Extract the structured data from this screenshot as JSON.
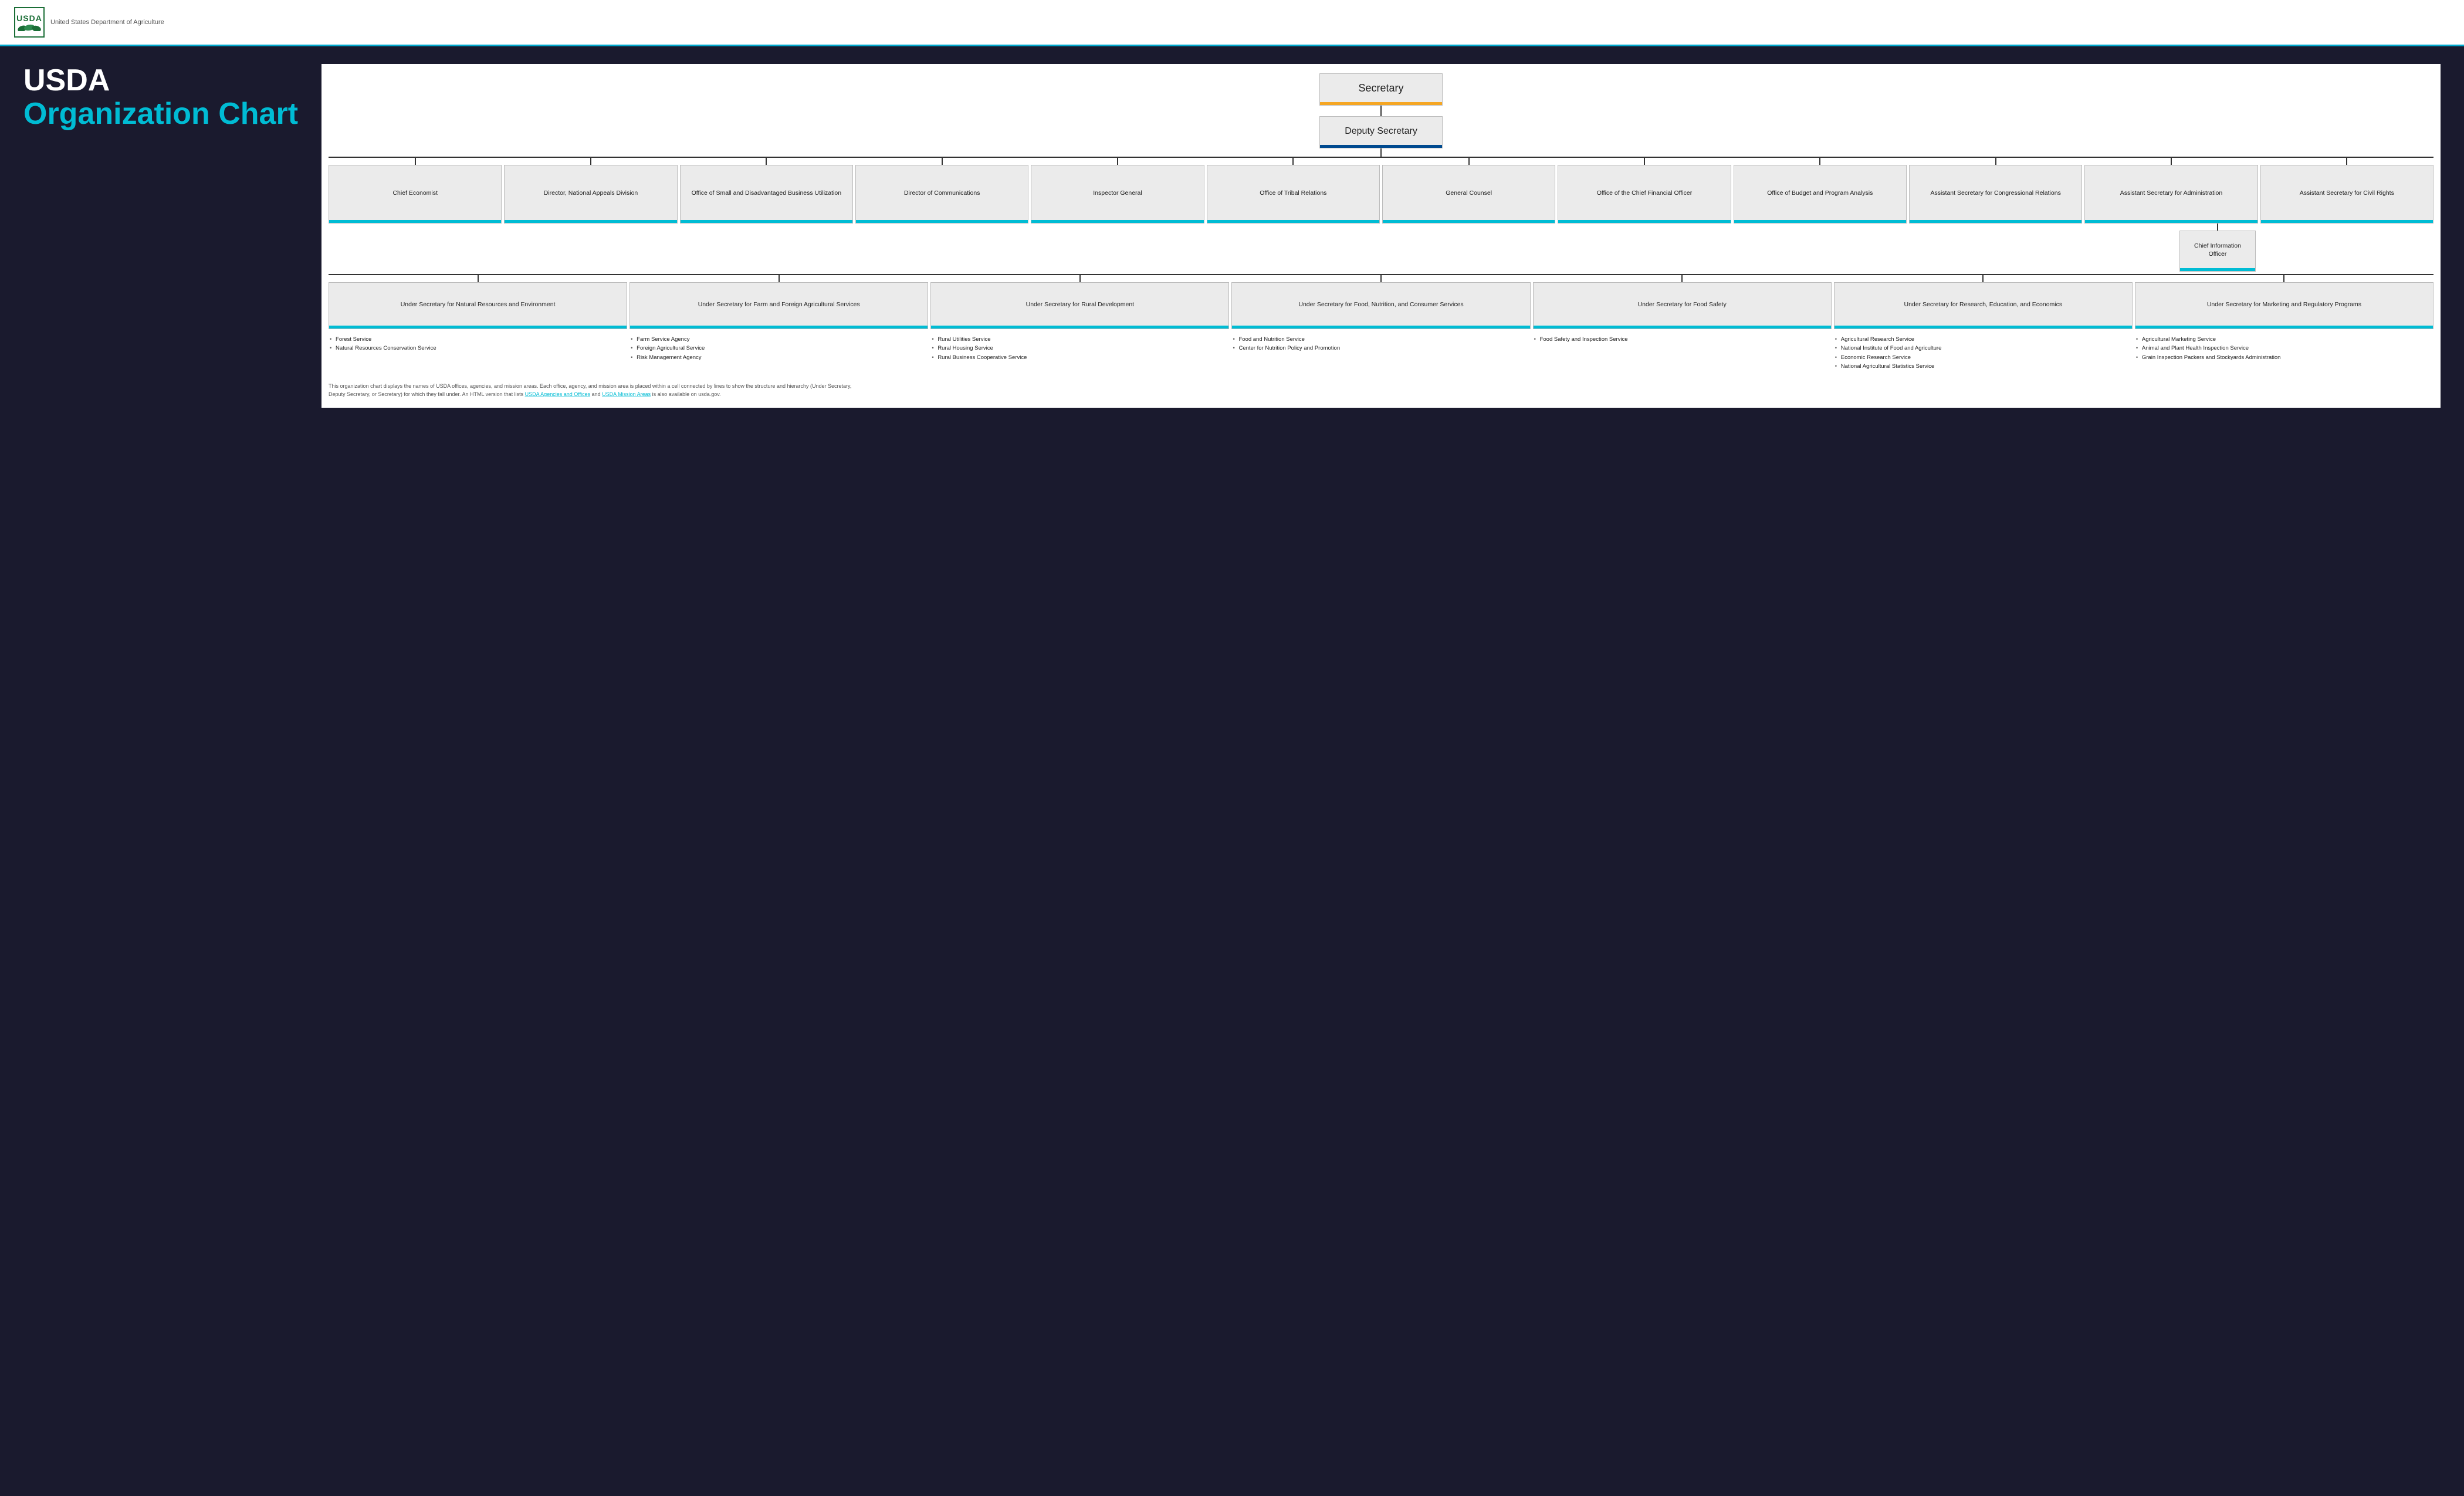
{
  "header": {
    "logo_text": "USDA",
    "dept_name": "United States Department of Agriculture"
  },
  "title": {
    "line1": "USDA",
    "line2": "Organization Chart"
  },
  "nodes": {
    "secretary": "Secretary",
    "deputy_secretary": "Deputy Secretary",
    "level1_left": [
      {
        "id": "chief-economist",
        "label": "Chief Economist"
      },
      {
        "id": "director-nad",
        "label": "Director, National Appeals Division"
      },
      {
        "id": "office-sdbu",
        "label": "Office of Small and Disadvantaged Business Utilization"
      },
      {
        "id": "director-comm",
        "label": "Director of Communications"
      },
      {
        "id": "inspector-general",
        "label": "Inspector General"
      },
      {
        "id": "office-tribal",
        "label": "Office of Tribal Relations"
      }
    ],
    "level1_right": [
      {
        "id": "general-counsel",
        "label": "General Counsel"
      },
      {
        "id": "office-cfo",
        "label": "Office of the Chief Financial Officer"
      },
      {
        "id": "office-bpa",
        "label": "Office of Budget and Program Analysis"
      },
      {
        "id": "asst-sec-congressional",
        "label": "Assistant Secretary for Congressional Relations"
      },
      {
        "id": "asst-sec-admin",
        "label": "Assistant Secretary for Administration"
      },
      {
        "id": "asst-sec-civil-rights",
        "label": "Assistant Secretary for Civil Rights"
      }
    ],
    "cio": {
      "id": "cio",
      "label": "Chief Information Officer"
    },
    "level2": [
      {
        "id": "usec-natural",
        "label": "Under Secretary for Natural Resources and Environment"
      },
      {
        "id": "usec-farm",
        "label": "Under Secretary for Farm and Foreign Agricultural Services"
      },
      {
        "id": "usec-rural",
        "label": "Under Secretary for Rural Development"
      },
      {
        "id": "usec-food-nutrition",
        "label": "Under Secretary for Food, Nutrition, and Consumer Services"
      },
      {
        "id": "usec-food-safety",
        "label": "Under Secretary for Food Safety"
      },
      {
        "id": "usec-research",
        "label": "Under Secretary for Research, Education, and Economics"
      },
      {
        "id": "usec-marketing",
        "label": "Under Secretary for Marketing and Regulatory Programs"
      }
    ],
    "agencies": [
      {
        "col_id": "natural",
        "items": [
          "Forest Service",
          "Natural Resources Conservation Service"
        ]
      },
      {
        "col_id": "farm",
        "items": [
          "Farm Service Agency",
          "Foreign Agricultural Service",
          "Risk Management Agency"
        ]
      },
      {
        "col_id": "rural",
        "items": [
          "Rural Utilities Service",
          "Rural Housing Service",
          "Rural Business Cooperative Service"
        ]
      },
      {
        "col_id": "food-nutrition",
        "items": [
          "Food and Nutrition Service",
          "Center for Nutrition Policy and Promotion"
        ]
      },
      {
        "col_id": "food-safety",
        "items": [
          "Food Safety and Inspection Service"
        ]
      },
      {
        "col_id": "research",
        "items": [
          "Agricultural Research Service",
          "National Institute of Food and Agriculture",
          "Economic Research Service",
          "National Agricultural Statistics Service"
        ]
      },
      {
        "col_id": "marketing",
        "items": [
          "Agricultural Marketing Service",
          "Animal and Plant Health Inspection Service",
          "Grain Inspection Packers and Stockyards Administration"
        ]
      }
    ]
  },
  "footer": {
    "text1": "This organization chart displays the names of USDA offices, agencies, and mission areas. Each office, agency, and mission area is placed within a cell connected by lines to show the structure and hierarchy (Under Secretary, Deputy Secretary, or Secretary) for which they fall under. An HTML version that lists ",
    "link1_text": "USDA Agencies and Offices",
    "link1_href": "#",
    "text2": " and ",
    "link2_text": "USDA Mission Areas",
    "link2_href": "#",
    "text3": " is also available on usda.gov."
  },
  "colors": {
    "background": "#1a1a2e",
    "header_bg": "#ffffff",
    "accent_cyan": "#00bcd4",
    "accent_gold": "#f5a623",
    "accent_navy": "#004a8f",
    "box_bg": "#ebebeb",
    "box_border": "#bbbbbb",
    "line_color": "#333333",
    "title_white": "#ffffff",
    "title_cyan": "#00bcd4"
  }
}
